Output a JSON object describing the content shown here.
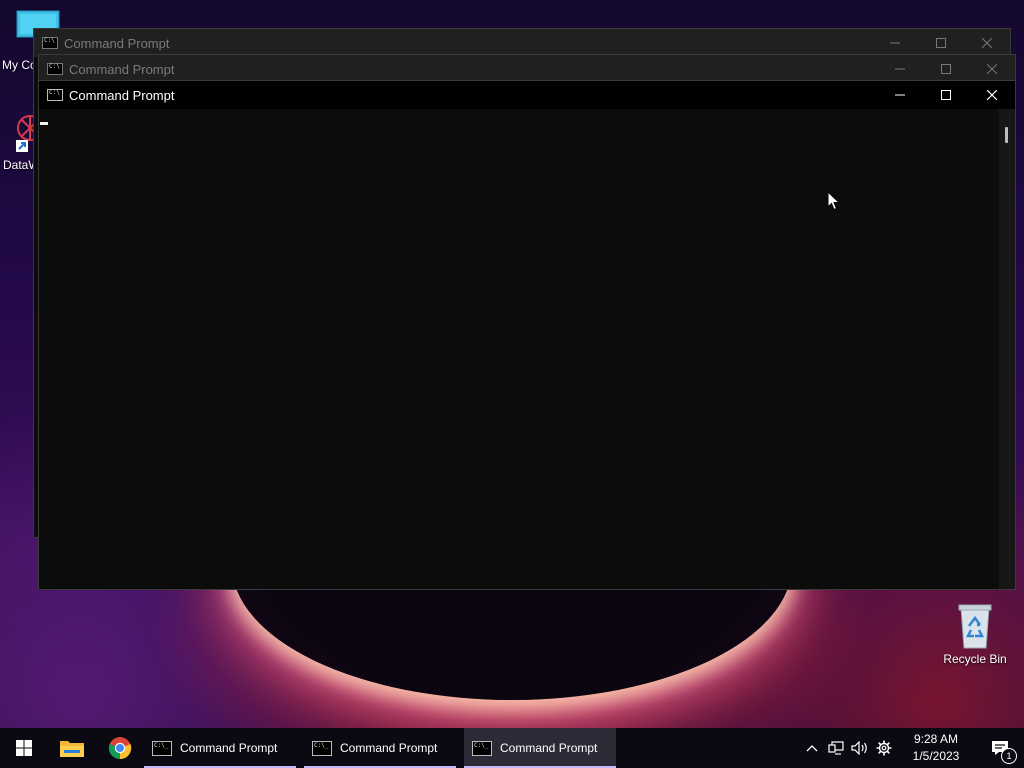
{
  "desktop": {
    "icons": [
      {
        "label": "My Co",
        "icon": "monitor-icon"
      },
      {
        "label": "DataW",
        "icon": "datawarehouse-shortcut-icon"
      },
      {
        "label": "Recycle Bin",
        "icon": "recycle-bin-icon"
      }
    ]
  },
  "windows": [
    {
      "title": "Command Prompt",
      "state": "inactive"
    },
    {
      "title": "Command Prompt",
      "state": "inactive"
    },
    {
      "title": "Command Prompt",
      "state": "active"
    }
  ],
  "window_controls": {
    "minimize": "minimize-icon",
    "maximize": "maximize-icon",
    "close": "close-icon"
  },
  "taskbar": {
    "pinned": [
      {
        "name": "Start",
        "icon": "windows-start-icon"
      },
      {
        "name": "File Explorer",
        "icon": "folder-icon"
      },
      {
        "name": "Google Chrome",
        "icon": "chrome-icon"
      }
    ],
    "tasks": [
      {
        "label": "Command Prompt",
        "active": false
      },
      {
        "label": "Command Prompt",
        "active": false
      },
      {
        "label": "Command Prompt",
        "active": true
      }
    ],
    "tray": {
      "icons": [
        "chevron-up-icon",
        "network-icon",
        "volume-icon",
        "gear-icon"
      ],
      "time": "9:28 AM",
      "date": "1/5/2023",
      "notification_count": "1"
    }
  },
  "colors": {
    "console_bg": "#0c0c0c",
    "active_titlebar": "#000000",
    "inactive_titlebar": "#202020",
    "taskbar_bg": "#0b0a12",
    "task_indicator": "#c8b7ff"
  }
}
